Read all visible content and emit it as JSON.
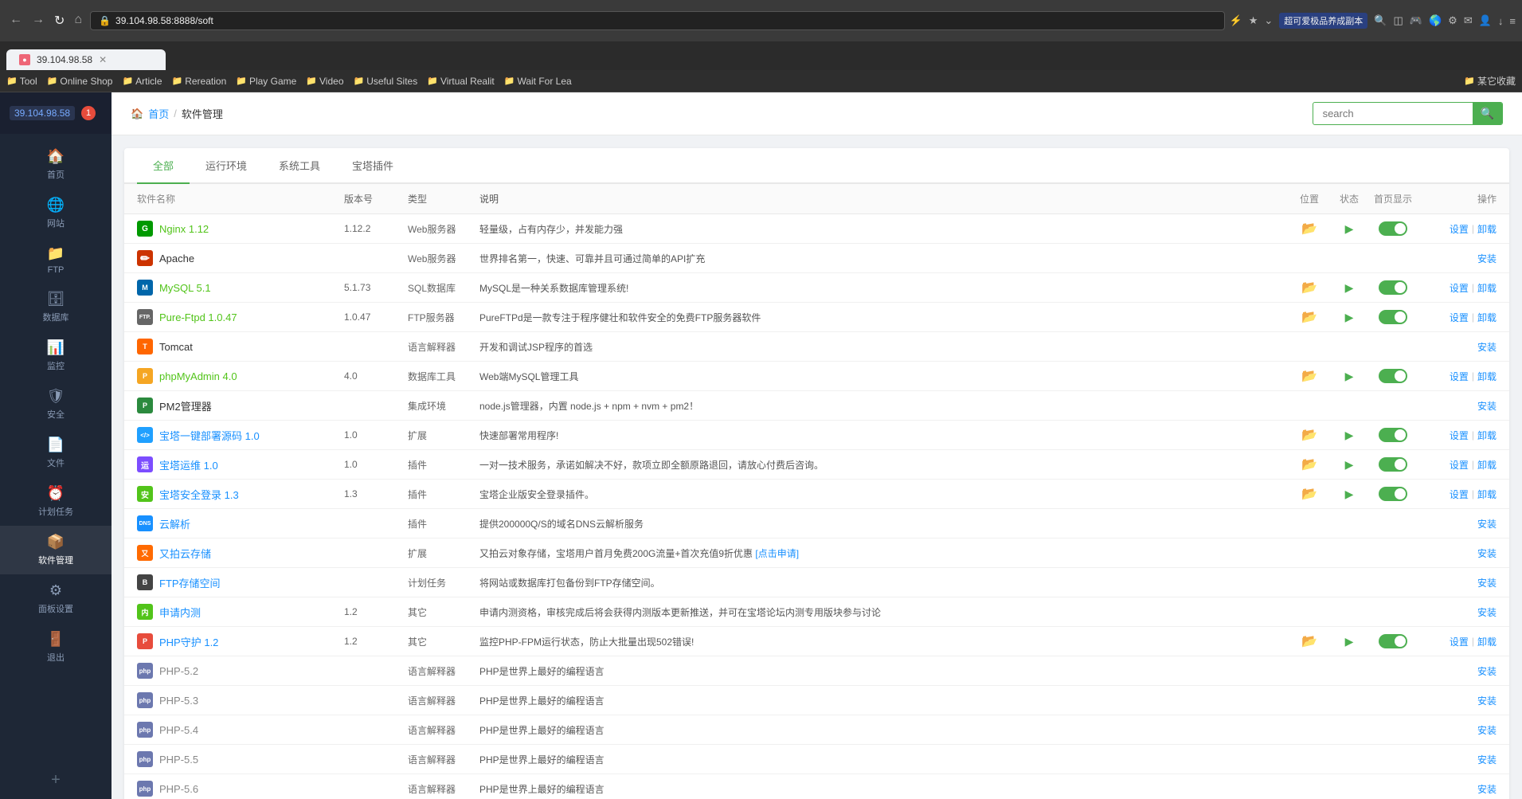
{
  "browser": {
    "address": "39.104.98.58:8888/soft",
    "tab_title": "39.104.98.58",
    "bookmarks": [
      {
        "label": "Tool"
      },
      {
        "label": "Online Shop"
      },
      {
        "label": "Article"
      },
      {
        "label": "Rereation"
      },
      {
        "label": "Play Game"
      },
      {
        "label": "Video"
      },
      {
        "label": "Useful Sites"
      },
      {
        "label": "Virtual Realit"
      },
      {
        "label": "Wait For Lea"
      }
    ],
    "right_bookmark": "某它收藏",
    "extension_label": "超可爱极品养成副本"
  },
  "sidebar": {
    "ip": "39.104.98.58",
    "notification": "1",
    "items": [
      {
        "label": "首页",
        "icon": "🏠",
        "id": "home"
      },
      {
        "label": "网站",
        "icon": "🌐",
        "id": "website"
      },
      {
        "label": "FTP",
        "icon": "📁",
        "id": "ftp"
      },
      {
        "label": "数据库",
        "icon": "🗄",
        "id": "database"
      },
      {
        "label": "监控",
        "icon": "📊",
        "id": "monitor"
      },
      {
        "label": "安全",
        "icon": "🛡",
        "id": "security"
      },
      {
        "label": "文件",
        "icon": "📄",
        "id": "files"
      },
      {
        "label": "计划任务",
        "icon": "⏰",
        "id": "cron"
      },
      {
        "label": "软件管理",
        "icon": "📦",
        "id": "software",
        "active": true
      },
      {
        "label": "面板设置",
        "icon": "⚙",
        "id": "settings"
      },
      {
        "label": "退出",
        "icon": "🚪",
        "id": "logout"
      }
    ]
  },
  "breadcrumb": {
    "home": "首页",
    "sep": "/",
    "current": "软件管理"
  },
  "search": {
    "placeholder": "search"
  },
  "tabs": [
    {
      "label": "全部",
      "active": true
    },
    {
      "label": "运行环境"
    },
    {
      "label": "系统工具"
    },
    {
      "label": "宝塔插件"
    }
  ],
  "table": {
    "headers": {
      "name": "软件名称",
      "version": "版本号",
      "type": "类型",
      "desc": "说明",
      "pos": "位置",
      "status": "状态",
      "homepage": "首页显示",
      "action": "操作"
    },
    "rows": [
      {
        "icon_type": "nginx",
        "icon_text": "G",
        "name": "Nginx 1.12",
        "name_color": "green",
        "version": "1.12.2",
        "type": "Web服务器",
        "desc": "轻量级，占有内存少，并发能力强",
        "has_pos": true,
        "has_status": true,
        "has_homepage": true,
        "toggle_on": true,
        "action_type": "settings",
        "action": [
          "设置",
          "卸载"
        ]
      },
      {
        "icon_type": "apache",
        "icon_text": "✏",
        "name": "Apache",
        "name_color": "normal",
        "version": "",
        "type": "Web服务器",
        "desc": "世界排名第一，快速、可靠并且可通过简单的API扩充",
        "has_pos": false,
        "has_status": false,
        "has_homepage": false,
        "toggle_on": false,
        "action_type": "install",
        "action": [
          "安装"
        ]
      },
      {
        "icon_type": "mysql",
        "icon_text": "M",
        "name": "MySQL 5.1",
        "name_color": "green",
        "version": "5.1.73",
        "type": "SQL数据库",
        "desc": "MySQL是一种关系数据库管理系统!",
        "has_pos": true,
        "has_status": true,
        "has_homepage": true,
        "toggle_on": true,
        "action_type": "settings",
        "action": [
          "设置",
          "卸载"
        ]
      },
      {
        "icon_type": "ftp",
        "icon_text": "FTP",
        "name": "Pure-Ftpd 1.0.47",
        "name_color": "green",
        "version": "1.0.47",
        "type": "FTP服务器",
        "desc": "PureFTPd是一款专注于程序健壮和软件安全的免费FTP服务器软件",
        "has_pos": true,
        "has_status": true,
        "has_homepage": true,
        "toggle_on": true,
        "action_type": "settings",
        "action": [
          "设置",
          "卸载"
        ]
      },
      {
        "icon_type": "tomcat",
        "icon_text": "T",
        "name": "Tomcat",
        "name_color": "normal",
        "version": "",
        "type": "语言解释器",
        "desc": "开发和调试JSP程序的首选",
        "has_pos": false,
        "has_status": false,
        "has_homepage": false,
        "toggle_on": false,
        "action_type": "install",
        "action": [
          "安装"
        ]
      },
      {
        "icon_type": "phpmyadmin",
        "icon_text": "P",
        "name": "phpMyAdmin 4.0",
        "name_color": "green",
        "version": "4.0",
        "type": "数据库工具",
        "desc": "Web端MySQL管理工具",
        "has_pos": true,
        "has_status": true,
        "has_homepage": true,
        "toggle_on": true,
        "action_type": "settings",
        "action": [
          "设置",
          "卸载"
        ]
      },
      {
        "icon_type": "pm2",
        "icon_text": "P",
        "name": "PM2管理器",
        "name_color": "normal",
        "version": "",
        "type": "集成环境",
        "desc": "node.js管理器，内置 node.js + npm + nvm + pm2！",
        "has_pos": false,
        "has_status": false,
        "has_homepage": false,
        "toggle_on": false,
        "action_type": "install",
        "action": [
          "安装"
        ]
      },
      {
        "icon_type": "bt",
        "icon_text": "</>",
        "name": "宝塔一键部署源码 1.0",
        "name_color": "blue",
        "version": "1.0",
        "type": "扩展",
        "desc": "快速部署常用程序!",
        "has_pos": true,
        "has_status": true,
        "has_homepage": true,
        "toggle_on": true,
        "action_type": "settings",
        "action": [
          "设置",
          "卸载"
        ]
      },
      {
        "icon_type": "plugin",
        "icon_text": "运",
        "name": "宝塔运维 1.0",
        "name_color": "blue",
        "version": "1.0",
        "type": "插件",
        "desc": "一对一技术服务，承诺如解决不好，款项立即全额原路退回，请放心付费后咨询。",
        "has_pos": true,
        "has_status": true,
        "has_homepage": true,
        "toggle_on": true,
        "action_type": "settings",
        "action": [
          "设置",
          "卸载"
        ]
      },
      {
        "icon_type": "plugin",
        "icon_text": "安",
        "name": "宝塔安全登录 1.3",
        "name_color": "blue",
        "version": "1.3",
        "type": "插件",
        "desc": "宝塔企业版安全登录插件。",
        "has_pos": true,
        "has_status": true,
        "has_homepage": true,
        "toggle_on": true,
        "action_type": "settings",
        "action": [
          "设置",
          "卸载"
        ]
      },
      {
        "icon_type": "dns",
        "icon_text": "DNS",
        "name": "云解析",
        "name_color": "blue",
        "version": "",
        "type": "插件",
        "desc": "提供200000Q/S的域名DNS云解析服务",
        "has_pos": false,
        "has_status": false,
        "has_homepage": false,
        "toggle_on": false,
        "action_type": "install",
        "action": [
          "安装"
        ]
      },
      {
        "icon_type": "ali",
        "icon_text": "又",
        "name": "又拍云存储",
        "name_color": "blue",
        "version": "",
        "type": "扩展",
        "desc": "又拍云对象存储，宝塔用户首月免费200G流量+首次充值9折优惠",
        "desc_link": "[点击申请]",
        "has_pos": false,
        "has_status": false,
        "has_homepage": false,
        "toggle_on": false,
        "action_type": "install",
        "action": [
          "安装"
        ]
      },
      {
        "icon_type": "backup",
        "icon_text": "B",
        "name": "FTP存储空间",
        "name_color": "blue",
        "version": "",
        "type": "计划任务",
        "desc": "将网站或数据库打包备份到FTP存储空间。",
        "has_pos": false,
        "has_status": false,
        "has_homepage": false,
        "toggle_on": false,
        "action_type": "install",
        "action": [
          "安装"
        ]
      },
      {
        "icon_type": "inner",
        "icon_text": "内",
        "name": "申请内测",
        "name_color": "blue",
        "version": "1.2",
        "type": "其它",
        "desc": "申请内测资格，审核完成后将会获得内测版本更新推送，并可在宝塔论坛内测专用版块参与讨论",
        "has_pos": false,
        "has_status": false,
        "has_homepage": false,
        "toggle_on": false,
        "action_type": "install",
        "action": [
          "安装"
        ]
      },
      {
        "icon_type": "phpguard",
        "icon_text": "P",
        "name": "PHP守护 1.2",
        "name_color": "blue",
        "version": "1.2",
        "type": "其它",
        "desc": "监控PHP-FPM运行状态，防止大批量出现502错误!",
        "has_pos": true,
        "has_status": true,
        "has_homepage": true,
        "toggle_on": true,
        "action_type": "settings",
        "action": [
          "设置",
          "卸载"
        ]
      },
      {
        "icon_type": "php",
        "icon_text": "php",
        "name": "PHP-5.2",
        "name_color": "gray",
        "version": "",
        "type": "语言解释器",
        "desc": "PHP是世界上最好的编程语言",
        "has_pos": false,
        "has_status": false,
        "has_homepage": false,
        "toggle_on": false,
        "action_type": "install",
        "action": [
          "安装"
        ]
      },
      {
        "icon_type": "php",
        "icon_text": "php",
        "name": "PHP-5.3",
        "name_color": "gray",
        "version": "",
        "type": "语言解释器",
        "desc": "PHP是世界上最好的编程语言",
        "has_pos": false,
        "has_status": false,
        "has_homepage": false,
        "toggle_on": false,
        "action_type": "install",
        "action": [
          "安装"
        ]
      },
      {
        "icon_type": "php",
        "icon_text": "php",
        "name": "PHP-5.4",
        "name_color": "gray",
        "version": "",
        "type": "语言解释器",
        "desc": "PHP是世界上最好的编程语言",
        "has_pos": false,
        "has_status": false,
        "has_homepage": false,
        "toggle_on": false,
        "action_type": "install",
        "action": [
          "安装"
        ]
      },
      {
        "icon_type": "php",
        "icon_text": "php",
        "name": "PHP-5.5",
        "name_color": "gray",
        "version": "",
        "type": "语言解释器",
        "desc": "PHP是世界上最好的编程语言",
        "has_pos": false,
        "has_status": false,
        "has_homepage": false,
        "toggle_on": false,
        "action_type": "install",
        "action": [
          "安装"
        ]
      },
      {
        "icon_type": "php",
        "icon_text": "php",
        "name": "PHP-5.6",
        "name_color": "gray",
        "version": "",
        "type": "语言解释器",
        "desc": "PHP是世界上最好的编程语言",
        "has_pos": false,
        "has_status": false,
        "has_homepage": false,
        "toggle_on": false,
        "action_type": "install",
        "action": [
          "安装"
        ]
      }
    ]
  }
}
